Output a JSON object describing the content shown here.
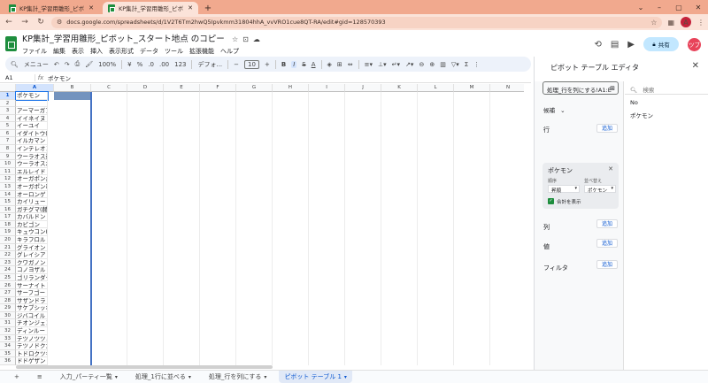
{
  "browser": {
    "tabs": [
      {
        "title": "KP集計_学習用雛形_ピボット_スタ",
        "active": false
      },
      {
        "title": "KP集計_学習用雛形_ピボット_スタ",
        "active": true
      }
    ],
    "url": "docs.google.com/spreadsheets/d/1V2T6Tm2hwQ5Ipvkmm31804hhA_vvVRO1cue8QT-RA/edit#gid=128570393",
    "profile_initial": "A"
  },
  "doc": {
    "title": "KP集計_学習用雛形_ピボット_スタート地点 のコピー",
    "menus": [
      "ファイル",
      "編集",
      "表示",
      "挿入",
      "表示形式",
      "データ",
      "ツール",
      "拡張機能",
      "ヘルプ"
    ],
    "share_label": "共有",
    "avatar_initial": "ツブ"
  },
  "toolbar": {
    "menu_label": "メニュー",
    "zoom": "100%",
    "currency": "¥",
    "percent": "%",
    "dec_dec": ".0",
    "dec_inc": ".00",
    "number_fmt": "123",
    "font": "デフォ...",
    "font_size": "10"
  },
  "formula": {
    "cell_ref": "A1",
    "value": "ポケモン"
  },
  "grid": {
    "columns": [
      "A",
      "B",
      "C",
      "D",
      "E",
      "F",
      "G",
      "H",
      "I",
      "J",
      "K",
      "L",
      "M",
      "N"
    ],
    "rows": [
      {
        "n": "1",
        "a": "ポケモン"
      },
      {
        "n": "2",
        "a": ""
      },
      {
        "n": "3",
        "a": "アーマーガア"
      },
      {
        "n": "4",
        "a": "イイネイヌ"
      },
      {
        "n": "5",
        "a": "イーユイ"
      },
      {
        "n": "6",
        "a": "イダイトウ(オ"
      },
      {
        "n": "7",
        "a": "イルカマン"
      },
      {
        "n": "8",
        "a": "インテレオン"
      },
      {
        "n": "9",
        "a": "ウーラオス連"
      },
      {
        "n": "10",
        "a": "ウーラオス水"
      },
      {
        "n": "11",
        "a": "エルレイド"
      },
      {
        "n": "12",
        "a": "オーガポン井戸"
      },
      {
        "n": "13",
        "a": "オーガポン竈"
      },
      {
        "n": "14",
        "a": "オーロンゲ"
      },
      {
        "n": "15",
        "a": "カイリュー"
      },
      {
        "n": "16",
        "a": "ガチグマ(赫"
      },
      {
        "n": "17",
        "a": "カバルドン"
      },
      {
        "n": "18",
        "a": "カビゴン"
      },
      {
        "n": "19",
        "a": "キュウコン(A"
      },
      {
        "n": "20",
        "a": "キラフロル"
      },
      {
        "n": "21",
        "a": "グライオン"
      },
      {
        "n": "22",
        "a": "グレイシア"
      },
      {
        "n": "23",
        "a": "クワガノン"
      },
      {
        "n": "24",
        "a": "コノヨザル"
      },
      {
        "n": "25",
        "a": "ゴリランダー"
      },
      {
        "n": "26",
        "a": "サーナイト"
      },
      {
        "n": "27",
        "a": "サーフゴー"
      },
      {
        "n": "28",
        "a": "サザンドラ"
      },
      {
        "n": "29",
        "a": "サケブシッポ"
      },
      {
        "n": "30",
        "a": "ジバコイル"
      },
      {
        "n": "31",
        "a": "チオンジェン"
      },
      {
        "n": "32",
        "a": "ディンルー"
      },
      {
        "n": "33",
        "a": "テツノツツミ"
      },
      {
        "n": "34",
        "a": "テツノドクガ"
      },
      {
        "n": "35",
        "a": "トドロクツキ"
      },
      {
        "n": "36",
        "a": "ドドゲザン"
      }
    ]
  },
  "sheet_tabs": {
    "items": [
      "入力_パーティ一覧",
      "処理_1行に並べる",
      "処理_行を列にする",
      "ピボット テーブル 1"
    ],
    "active_index": 3
  },
  "pivot": {
    "title": "ピボット テーブル エディタ",
    "range": "処理_行を列にする!A1:E",
    "suggest_label": "候補",
    "rows_label": "行",
    "columns_label": "列",
    "values_label": "値",
    "filter_label": "フィルタ",
    "add_label": "追加",
    "card": {
      "name": "ポケモン",
      "order_label": "順序",
      "order_value": "昇順",
      "sort_label": "並べ替え",
      "sort_value": "ポケモン",
      "totals_label": "合計を表示"
    },
    "search_placeholder": "検索",
    "fields": [
      "No",
      "ポケモン"
    ]
  }
}
